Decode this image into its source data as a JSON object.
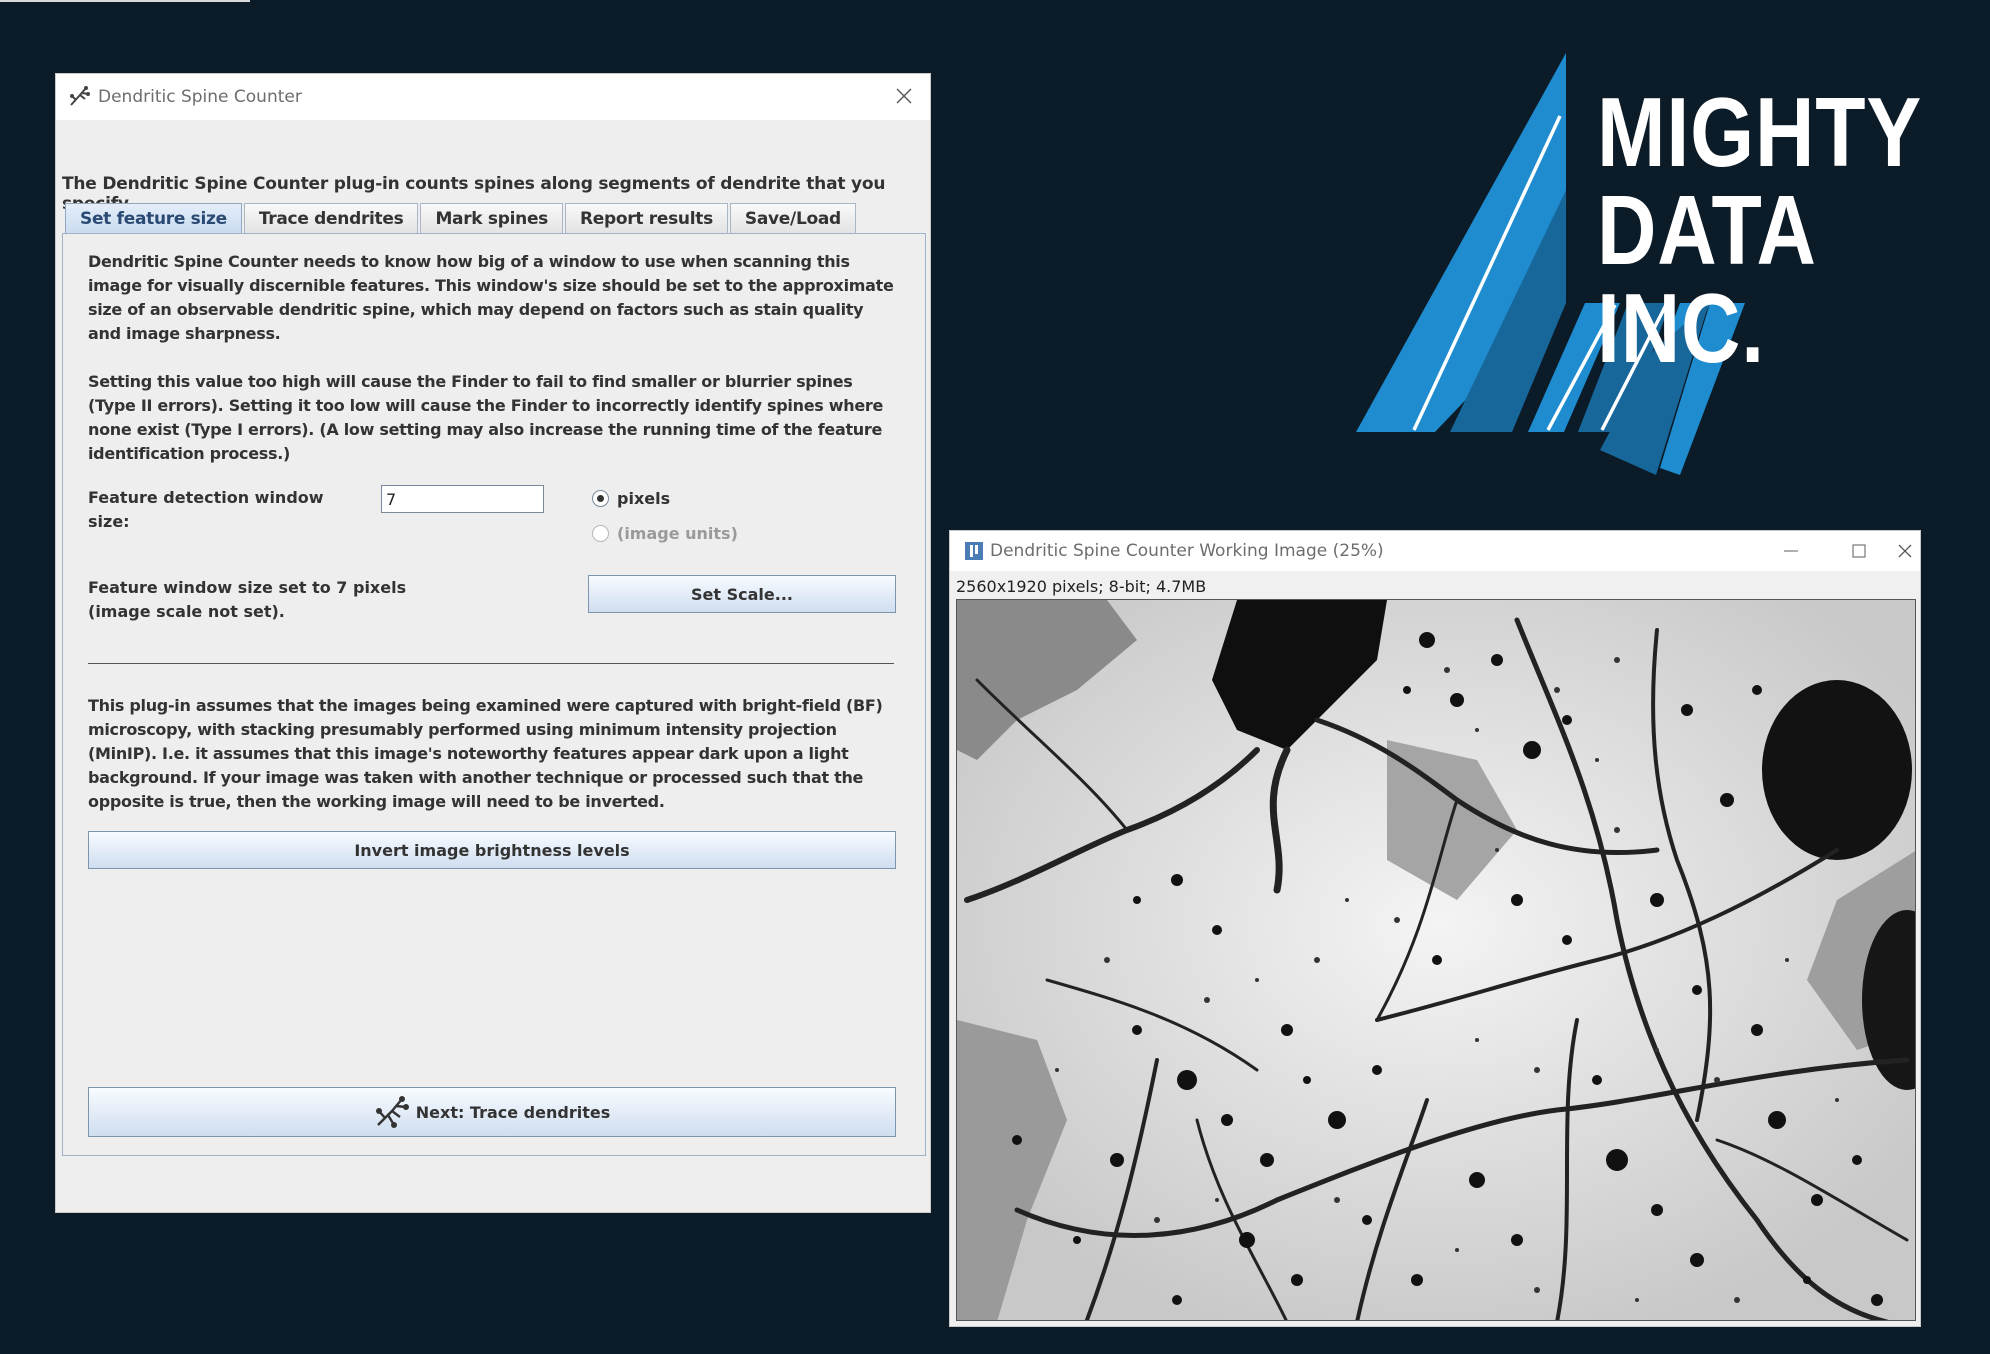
{
  "plugin_window": {
    "title": "Dendritic Spine Counter",
    "intro": "The Dendritic Spine Counter plug-in counts spines along segments of dendrite that you specify.",
    "tabs": [
      {
        "label": "Set feature size",
        "active": true
      },
      {
        "label": "Trace dendrites",
        "active": false
      },
      {
        "label": "Mark spines",
        "active": false
      },
      {
        "label": "Report results",
        "active": false
      },
      {
        "label": "Save/Load",
        "active": false
      }
    ],
    "para1": "Dendritic Spine Counter needs to know how big of a window to use when scanning this image for visually discernible features. This window's size should be set to the approximate size of an observable dendritic spine, which may depend on factors such as stain quality and image sharpness.",
    "para2": "Setting this value too high will cause the Finder to fail to find smaller or blurrier spines (Type II errors). Setting it too low will cause the Finder to incorrectly identify spines where none exist (Type I errors). (A low setting may also increase the running time of the feature identification process.)",
    "feature_label": "Feature detection window size:",
    "feature_value": "7",
    "radio_pixels": "pixels",
    "radio_image_units": "(image units)",
    "selected_unit": "pixels",
    "status_line1": "Feature window size set to 7 pixels",
    "status_line2": "(image scale not set).",
    "set_scale_button": "Set Scale...",
    "para3": "This plug-in assumes that the images being examined were captured with bright-field (BF) microscopy, with stacking presumably performed using minimum intensity projection (MinIP). I.e. it assumes that this image's noteworthy features appear dark upon a light background. If your image was taken with another technique or processed such that the opposite is true, then the working image will need to be inverted.",
    "invert_button": "Invert image brightness levels",
    "next_button": "Next: Trace dendrites"
  },
  "logo": {
    "line1": "MIGHTY",
    "line2": "DATA INC.",
    "colors": {
      "light_blue": "#1e8ccf",
      "dark_blue": "#17679b",
      "navy": "#0b1b28"
    }
  },
  "image_window": {
    "title": "Dendritic Spine Counter Working Image (25%)",
    "info": "2560x1920 pixels; 8-bit; 4.7MB"
  },
  "icons": [
    "spine-counter-app-icon",
    "close-icon",
    "minimize-icon",
    "maximize-icon",
    "imagej-icon"
  ]
}
